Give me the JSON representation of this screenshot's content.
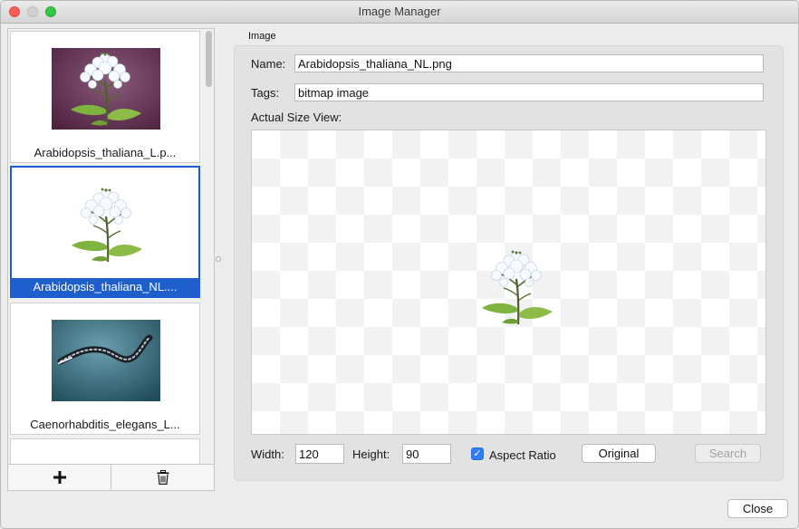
{
  "window": {
    "title": "Image Manager"
  },
  "image_list": {
    "items": [
      {
        "label": "Arabidopsis_thaliana_L.p...",
        "selected": false
      },
      {
        "label": "Arabidopsis_thaliana_NL....",
        "selected": true
      },
      {
        "label": "Caenorhabditis_elegans_L...",
        "selected": false
      }
    ],
    "add_icon": "plus-icon",
    "delete_icon": "trash-icon"
  },
  "image_group": {
    "title": "Image",
    "name_label": "Name:",
    "name_value": "Arabidopsis_thaliana_NL.png",
    "tags_label": "Tags:",
    "tags_value": "bitmap image",
    "actual_size_label": "Actual Size View:"
  },
  "size_controls": {
    "width_label": "Width:",
    "width_value": "120",
    "height_label": "Height:",
    "height_value": "90",
    "aspect_ratio_label": "Aspect Ratio",
    "aspect_ratio_checked": true,
    "original_label": "Original",
    "search_label": "Search"
  },
  "footer": {
    "close_label": "Close"
  },
  "colors": {
    "selection": "#1f5fcc",
    "checkbox": "#2f7ef5",
    "close_button": "#fc5f57",
    "zoom_button": "#33c748"
  }
}
